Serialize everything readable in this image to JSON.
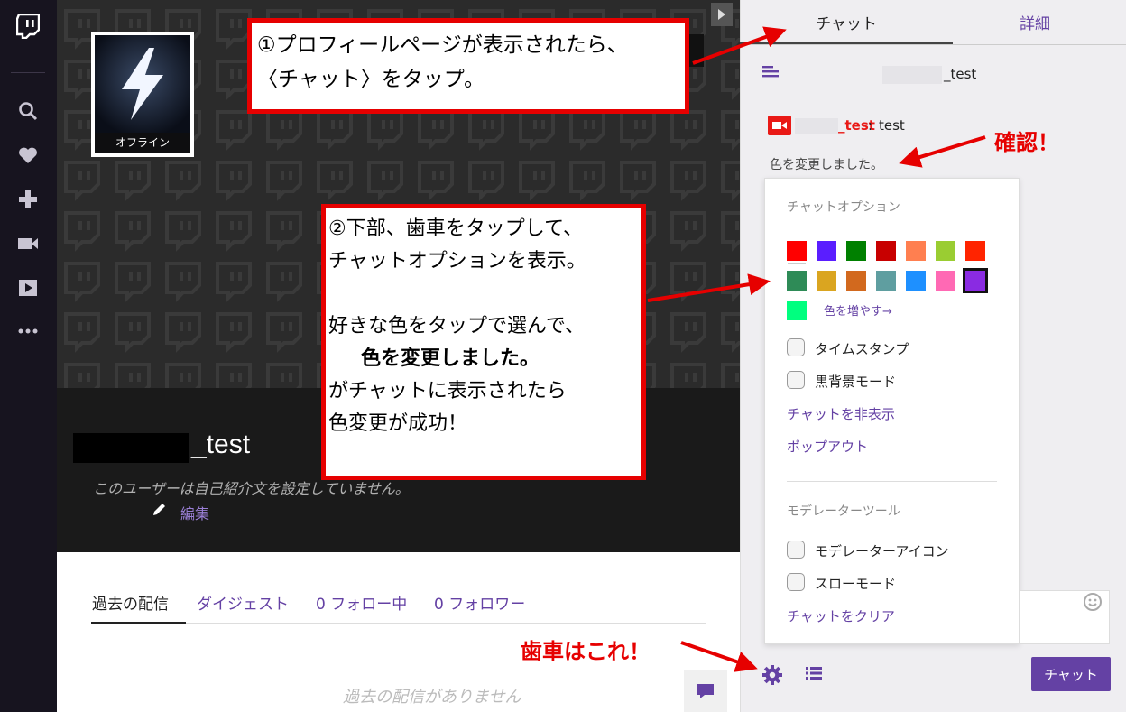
{
  "profile": {
    "offline_label": "オフライン",
    "username_suffix": "_test",
    "bio": "このユーザーは自己紹介文を設定していません。",
    "edit_label": "編集"
  },
  "tabs": [
    {
      "label": "過去の配信"
    },
    {
      "label": "ダイジェスト"
    },
    {
      "label": "0 フォロー中"
    },
    {
      "label": "0 フォロワー"
    }
  ],
  "empty_message": "過去の配信がありません",
  "chat": {
    "tab_chat": "チャット",
    "tab_detail": "詳細",
    "room_suffix": "_test",
    "message": {
      "user_suffix": "_test",
      "separator": ":",
      "text": "test"
    },
    "notice": "色を変更しました。",
    "send_label": "チャット"
  },
  "chat_options": {
    "heading": "チャットオプション",
    "colors": [
      "#ff0000",
      "#5a1eff",
      "#008000",
      "#c80000",
      "#ff7f50",
      "#9acd32",
      "#ff2400",
      "#2e8b57",
      "#daa520",
      "#d2691e",
      "#5f9ea0",
      "#1e90ff",
      "#ff69b4",
      "#8a2be2",
      "#00ff7f"
    ],
    "selected_color": "#8a2be2",
    "more_colors": "色を増やす→",
    "timestamp_label": "タイムスタンプ",
    "dark_mode_label": "黒背景モード",
    "hide_chat": "チャットを非表示",
    "popout": "ポップアウト",
    "mod_heading": "モデレーターツール",
    "mod_icons_label": "モデレーターアイコン",
    "slow_mode_label": "スローモード",
    "clear_chat": "チャットをクリア"
  },
  "annotations": {
    "callout1_line1": "①プロフィールページが表示されたら、",
    "callout1_line2": "〈チャット〉をタップ。",
    "callout2_line1": "②下部、歯車をタップして、",
    "callout2_line2": "チャットオプションを表示。",
    "callout2_line3": "好きな色をタップで選んで、",
    "callout2_line4": "色を変更しました。",
    "callout2_line5": "がチャットに表示されたら",
    "callout2_line6": "色変更が成功！",
    "confirm": "確認！",
    "gear_note": "歯車はこれ！"
  },
  "colors": {
    "accent": "#6441a4",
    "annotation_red": "#e60000",
    "nav_bg": "#17141f"
  }
}
